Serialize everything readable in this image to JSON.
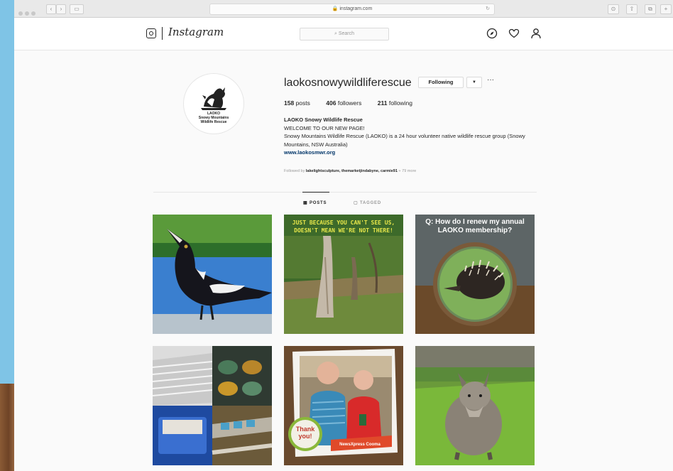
{
  "browser": {
    "url": "instagram.com"
  },
  "header": {
    "logo_text": "Instagram",
    "search_placeholder": "Search"
  },
  "profile": {
    "username": "laokosnowywildliferescue",
    "follow_button": "Following",
    "more_label": "···",
    "stats": {
      "posts": "158",
      "posts_label": "posts",
      "followers": "406",
      "followers_label": "followers",
      "following": "211",
      "following_label": "following"
    },
    "full_name": "LAOKO Snowy Wildlife Rescue",
    "bio_line1": "WELCOME TO OUR NEW PAGE!",
    "bio_line2": "Snowy Mountains Wildlife Rescue (LAOKO) is a 24 hour volunteer native wildlife rescue group (Snowy Mountains, NSW Australia)",
    "website": "www.laokosmwr.org",
    "followed_by_prefix": "Followed by",
    "followed_by_names": "lakelightsculpture, themarketjindabyne, carmie91",
    "followed_by_more": "+ 79 more",
    "avatar_text": "LAOKO\nSnowy Mountains\nWildlife Rescue"
  },
  "tabs": [
    {
      "label": "POSTS",
      "active": true
    },
    {
      "label": "TAGGED",
      "active": false
    }
  ],
  "posts": {
    "post2_text": "JUST BECAUSE YOU CAN'T SEE US, DOESN'T MEAN WE'RE NOT THERE!",
    "post3_text": "Q: How do I renew my annual LAOKO membership?",
    "post5_badge_line1": "Thank",
    "post5_badge_line2": "you!",
    "post5_caption": "NewsXpress Cooma"
  },
  "colors": {
    "brand_text": "#262626",
    "link": "#003569",
    "wallpaper": "#7fc4e6"
  }
}
